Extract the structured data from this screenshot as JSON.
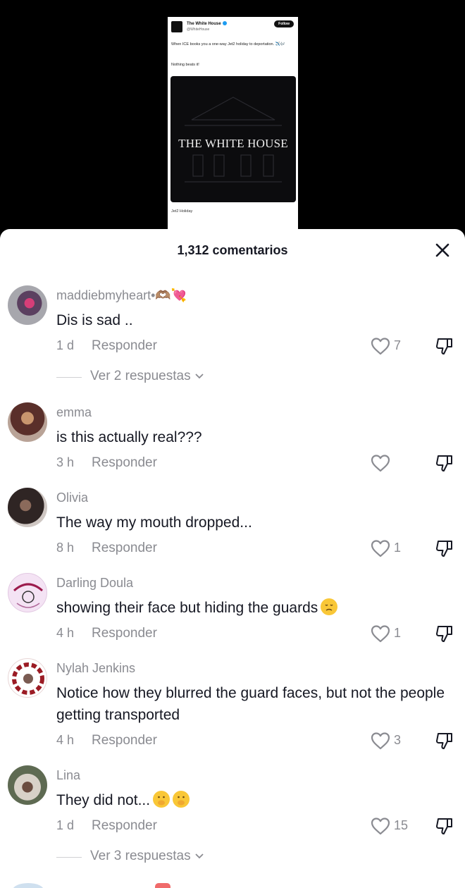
{
  "tweet": {
    "account_name": "The White House",
    "handle": "@WhiteHouse",
    "follow_label": "Follow",
    "text": "When ICE books you a one-way Jet2 holiday to deportation. ✈️🎶",
    "text2": "Nothing beats it!",
    "media_title": "THE WHITE HOUSE",
    "caption": "Jet2 Holiday"
  },
  "sheet": {
    "title": "1,312 comentarios",
    "reply_label": "Responder"
  },
  "comments": [
    {
      "user": "maddiebmyheart•🫶🏽💘",
      "text": "Dis is sad ..",
      "time": "1 d",
      "likes": "7",
      "replies": "Ver 2 respuestas"
    },
    {
      "user": "emma",
      "text": "is this actually real???",
      "time": "3 h",
      "likes": ""
    },
    {
      "user": "Olivia",
      "text": "The way my mouth dropped...",
      "time": "8 h",
      "likes": "1"
    },
    {
      "user": "Darling Doula",
      "text": "showing their face but hiding the guards",
      "time": "4 h",
      "likes": "1"
    },
    {
      "user": "Nylah Jenkins",
      "text": "Notice how they blurred the guard faces, but not the people getting transported",
      "time": "4 h",
      "likes": "3"
    },
    {
      "user": "Lina",
      "text": "They did not...",
      "time": "1 d",
      "likes": "15",
      "replies": "Ver 3 respuestas"
    }
  ],
  "icons": {
    "close": "close-icon",
    "like": "heart-outline-icon",
    "dislike": "thumbs-down-icon",
    "chevron": "chevron-down-icon",
    "emoji_sad": "disappointed-face-emoji",
    "emoji_shush": "face-with-hand-over-mouth-emoji"
  },
  "colors": {
    "primary_text": "#161823",
    "secondary_text": "#8a8b91",
    "sheet_background": "#ffffff",
    "video_background": "#000000"
  }
}
